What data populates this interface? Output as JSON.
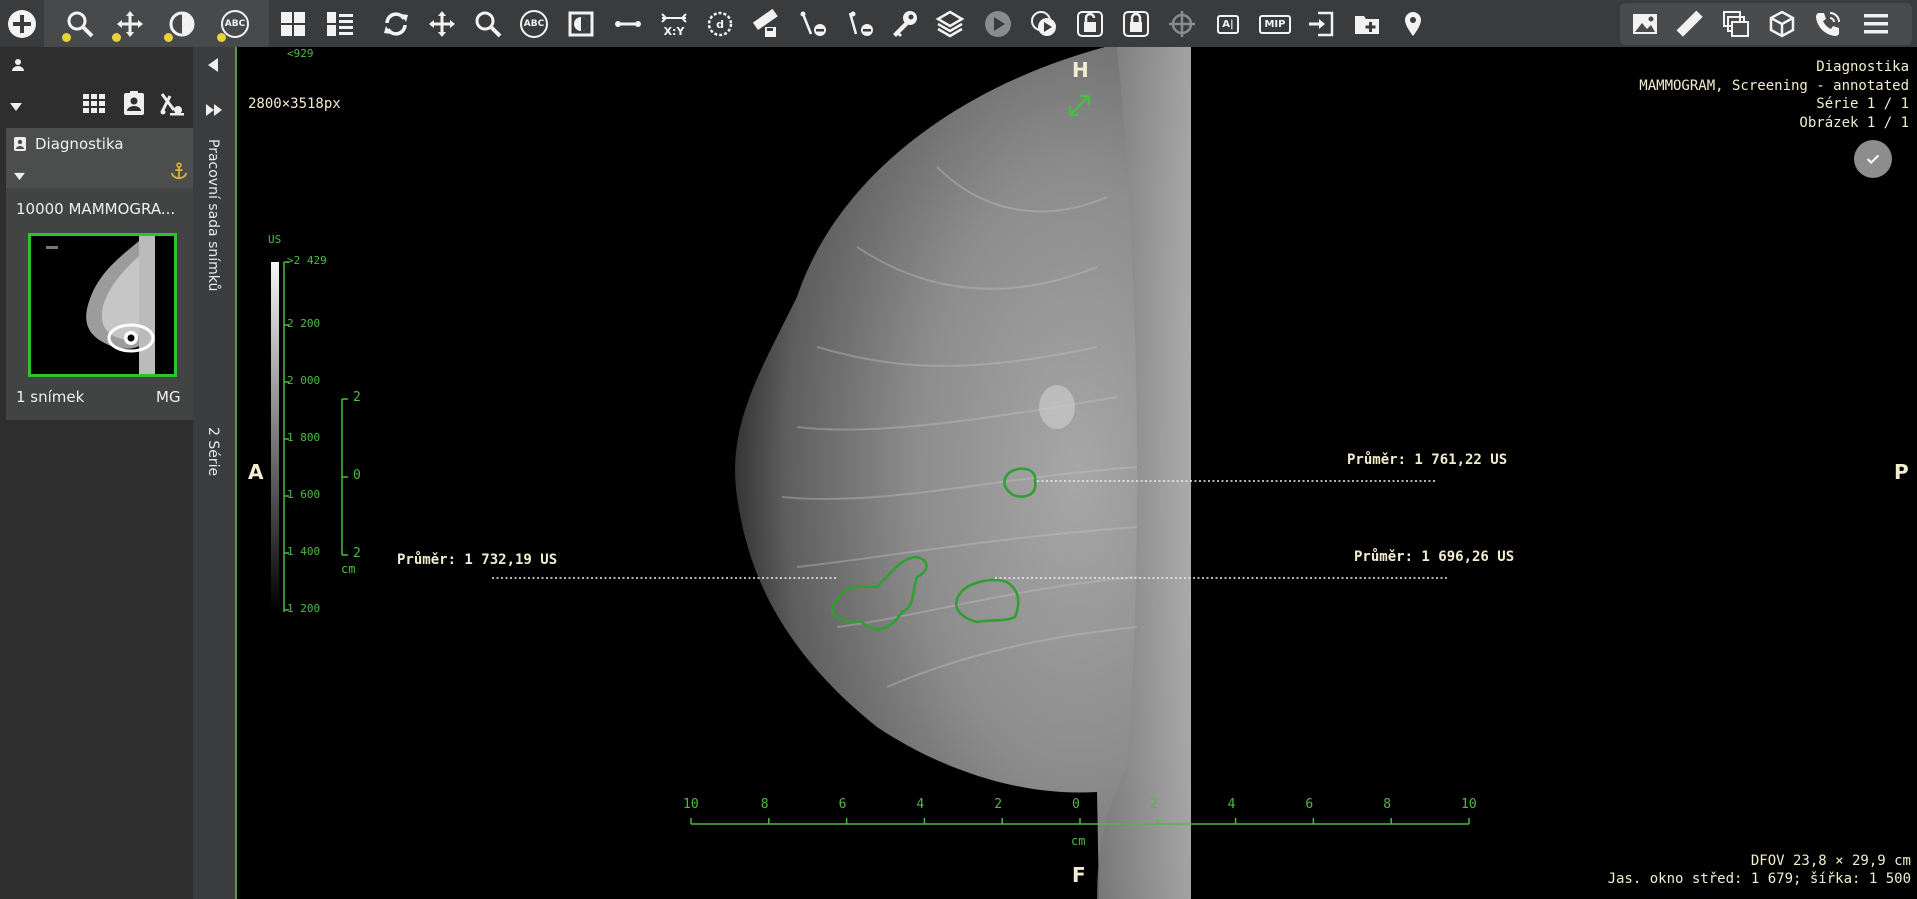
{
  "toolbar": {
    "left_icons": [
      "add-icon",
      "zoom-icon",
      "pan-icon",
      "contrast-icon",
      "abc-annotation-icon",
      "layout-grid-icon",
      "numbered-list-icon",
      "rotate-icon",
      "move-icon",
      "magnify-icon",
      "abc-text-icon",
      "invert-icon",
      "line-measure-icon",
      "xy-icon",
      "distance-icon",
      "ruler-save-icon",
      "angle-remove-icon",
      "roi-remove-icon",
      "key-icon",
      "layers-icon",
      "play-icon",
      "cine-icon",
      "unlock-icon",
      "lock-icon",
      "crosshair-icon",
      "ai-icon",
      "mip-icon",
      "export-icon",
      "add-folder-icon",
      "location-pin-icon"
    ],
    "xy_label": "X:Y",
    "mip_label": "MIP",
    "ai_label": "A|",
    "right_icons": [
      "image-icon",
      "ruler-icon",
      "windows-icon",
      "cube-icon",
      "phone-icon",
      "menu-icon"
    ]
  },
  "left": {
    "worksheet_label": "Pracovní sada snímků",
    "series_label": "2 Série",
    "study_title": "Diagnostika",
    "series_name": "10000  MAMMOGRA...",
    "image_count": "1 snímek",
    "modality": "MG"
  },
  "viewer": {
    "image_size": "2800×3518px",
    "info_lines": [
      "Diagnostika",
      "MAMMOGRAM, Screening - annotated",
      "Série 1 / 1",
      "Obrázek 1 / 1"
    ],
    "orientation": {
      "top": "H",
      "bottom": "F",
      "left": "A",
      "right": "P"
    },
    "dfov": "DFOV 23,8 × 29,9 cm",
    "window": "Jas. okno střed: 1 679; šířka: 1 500",
    "measurements": [
      {
        "label": "Průměr: 1 761,22  US"
      },
      {
        "label": "Průměr: 1 696,26  US"
      },
      {
        "label": "Průměr: 1 732,19  US"
      }
    ],
    "colorbar": {
      "unit": "US",
      "ticks": [
        ">2 429",
        "2 200",
        "2 000",
        "1 800",
        "1 600",
        "1 400",
        "1 200",
        "<929"
      ]
    },
    "vscale": {
      "ticks": [
        "2",
        "0",
        "2"
      ],
      "unit": "cm"
    },
    "hscale": {
      "ticks": [
        "10",
        "8",
        "6",
        "4",
        "2",
        "0",
        "2",
        "4",
        "6",
        "8",
        "10"
      ],
      "unit": "cm"
    },
    "colors": {
      "overlay_text": "#f2edd0",
      "annotation": "#4dbb42"
    }
  }
}
